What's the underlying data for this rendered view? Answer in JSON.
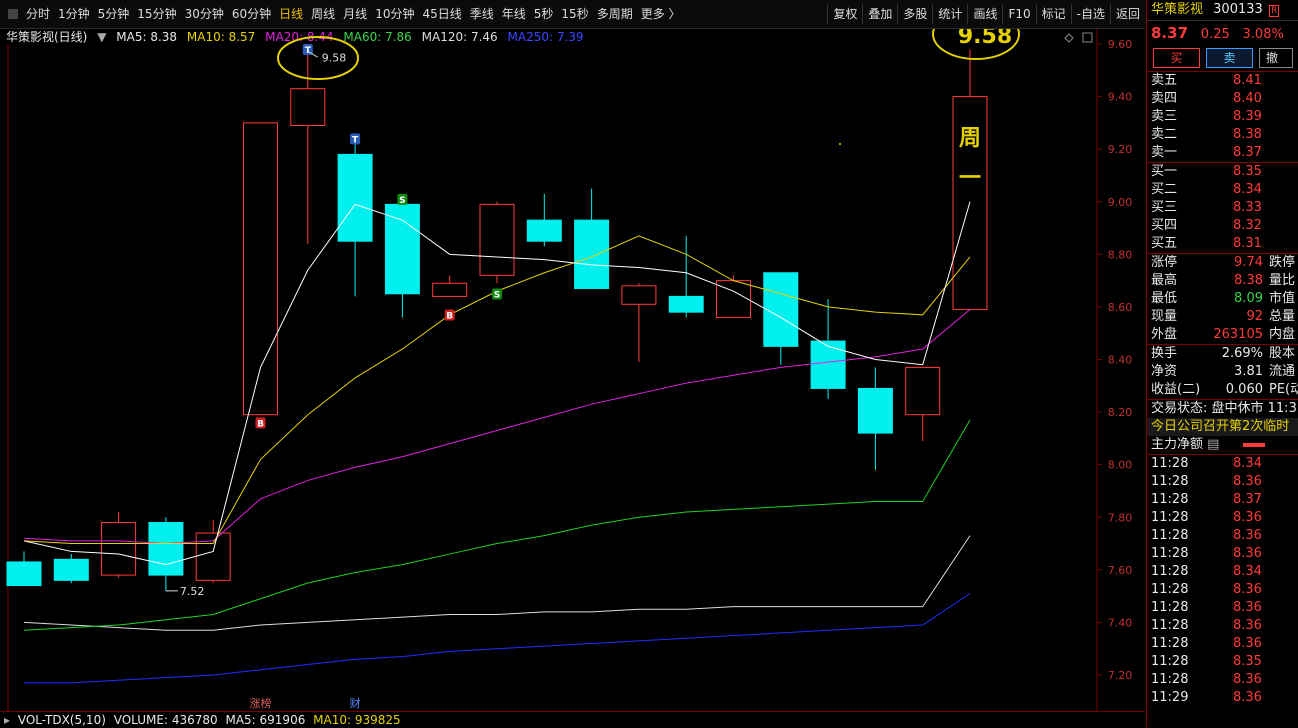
{
  "toolbar": {
    "periods": [
      "分时",
      "1分钟",
      "5分钟",
      "15分钟",
      "30分钟",
      "60分钟",
      "日线",
      "周线",
      "月线",
      "10分钟",
      "45日线",
      "季线",
      "年线",
      "5秒",
      "15秒",
      "多周期",
      "更多 〉"
    ],
    "active_period": "日线",
    "right_buttons": [
      "复权",
      "叠加",
      "多股",
      "统计",
      "画线",
      "F10",
      "标记",
      "-自选",
      "返回"
    ]
  },
  "legend": {
    "name": "华策影视(日线)",
    "ma5": "MA5: 8.38",
    "ma10": "MA10: 8.57",
    "ma20": "MA20: 8.44",
    "ma60": "MA60: 7.86",
    "ma120": "MA120: 7.46",
    "ma250": "MA250: 7.39"
  },
  "annotations": {
    "high_label": "9.58",
    "low_label": "7.52",
    "big_high": "9.58",
    "zhou": "周",
    "yi": "一",
    "zhangbang": "涨榜",
    "cai": "财",
    "marker_b": "B",
    "marker_s": "S",
    "marker_t": "T"
  },
  "axis": {
    "ticks": [
      "9.60",
      "9.40",
      "9.20",
      "9.00",
      "8.80",
      "8.60",
      "8.40",
      "8.20",
      "8.00",
      "7.80",
      "7.60",
      "7.40",
      "7.20"
    ]
  },
  "volume_bar": {
    "label": "VOL-TDX(5,10)",
    "volume": "VOLUME: 436780",
    "ma5": "MA5: 691906",
    "ma10": "MA10: 939825"
  },
  "colors": {
    "up": "#ff3b3b",
    "down": "#00f0f0",
    "ma5": "#ffffff",
    "ma10": "#e6d200",
    "ma20": "#e020e0",
    "ma60": "#20d020",
    "ma120": "#dcdcdc",
    "ma250": "#2030ff"
  },
  "chart_data": {
    "type": "candlestick",
    "ylim": [
      7.15,
      9.65
    ],
    "candles": [
      {
        "o": 7.63,
        "h": 7.67,
        "l": 7.54,
        "c": 7.54
      },
      {
        "o": 7.64,
        "h": 7.66,
        "l": 7.55,
        "c": 7.56
      },
      {
        "o": 7.58,
        "h": 7.82,
        "l": 7.57,
        "c": 7.78
      },
      {
        "o": 7.78,
        "h": 7.8,
        "l": 7.52,
        "c": 7.58
      },
      {
        "o": 7.56,
        "h": 7.79,
        "l": 7.55,
        "c": 7.74
      },
      {
        "o": 8.19,
        "h": 9.3,
        "l": 8.19,
        "c": 9.3
      },
      {
        "o": 9.29,
        "h": 9.58,
        "l": 8.84,
        "c": 9.43
      },
      {
        "o": 9.18,
        "h": 9.24,
        "l": 8.64,
        "c": 8.85
      },
      {
        "o": 8.99,
        "h": 8.99,
        "l": 8.56,
        "c": 8.65
      },
      {
        "o": 8.64,
        "h": 8.72,
        "l": 8.64,
        "c": 8.69
      },
      {
        "o": 8.72,
        "h": 9.0,
        "l": 8.69,
        "c": 8.99
      },
      {
        "o": 8.93,
        "h": 9.03,
        "l": 8.83,
        "c": 8.85
      },
      {
        "o": 8.93,
        "h": 9.05,
        "l": 8.67,
        "c": 8.67
      },
      {
        "o": 8.61,
        "h": 8.69,
        "l": 8.39,
        "c": 8.68
      },
      {
        "o": 8.64,
        "h": 8.87,
        "l": 8.56,
        "c": 8.58
      },
      {
        "o": 8.56,
        "h": 8.72,
        "l": 8.56,
        "c": 8.7
      },
      {
        "o": 8.73,
        "h": 8.73,
        "l": 8.38,
        "c": 8.45
      },
      {
        "o": 8.47,
        "h": 8.63,
        "l": 8.25,
        "c": 8.29
      },
      {
        "o": 8.29,
        "h": 8.37,
        "l": 7.98,
        "c": 8.12
      },
      {
        "o": 8.19,
        "h": 8.37,
        "l": 8.09,
        "c": 8.37
      },
      {
        "o": 8.59,
        "h": 9.58,
        "l": 8.59,
        "c": 9.4
      }
    ],
    "ma": {
      "ma5": [
        7.71,
        7.67,
        7.66,
        7.62,
        7.67,
        8.37,
        8.74,
        8.99,
        8.93,
        8.8,
        8.79,
        8.78,
        8.76,
        8.75,
        8.73,
        8.66,
        8.56,
        8.45,
        8.4,
        8.38,
        9.0
      ],
      "ma10": [
        7.71,
        7.7,
        7.7,
        7.7,
        7.7,
        8.02,
        8.19,
        8.33,
        8.44,
        8.57,
        8.66,
        8.73,
        8.79,
        8.87,
        8.8,
        8.7,
        8.65,
        8.6,
        8.58,
        8.57,
        8.79
      ],
      "ma20": [
        7.72,
        7.71,
        7.71,
        7.7,
        7.71,
        7.87,
        7.94,
        7.99,
        8.03,
        8.08,
        8.13,
        8.18,
        8.23,
        8.27,
        8.31,
        8.34,
        8.37,
        8.39,
        8.41,
        8.44,
        8.59
      ],
      "ma60": [
        7.37,
        7.38,
        7.39,
        7.41,
        7.43,
        7.49,
        7.55,
        7.59,
        7.62,
        7.66,
        7.7,
        7.73,
        7.77,
        7.8,
        7.82,
        7.83,
        7.84,
        7.85,
        7.86,
        7.86,
        8.17
      ],
      "ma120": [
        7.4,
        7.39,
        7.38,
        7.37,
        7.37,
        7.39,
        7.4,
        7.41,
        7.42,
        7.43,
        7.43,
        7.44,
        7.44,
        7.45,
        7.45,
        7.46,
        7.46,
        7.46,
        7.46,
        7.46,
        7.73
      ],
      "ma250": [
        7.17,
        7.17,
        7.18,
        7.19,
        7.2,
        7.22,
        7.24,
        7.26,
        7.27,
        7.29,
        7.3,
        7.31,
        7.32,
        7.33,
        7.34,
        7.35,
        7.36,
        7.37,
        7.38,
        7.39,
        7.51
      ]
    }
  },
  "panel": {
    "name": "华策影视",
    "code": "300133",
    "tag": "R",
    "price": "8.37",
    "change": "0.25",
    "pct": "3.08%",
    "buy": "买",
    "sell": "卖",
    "cancel": "撤",
    "asks": [
      [
        "卖五",
        "8.41"
      ],
      [
        "卖四",
        "8.40"
      ],
      [
        "卖三",
        "8.39"
      ],
      [
        "卖二",
        "8.38"
      ],
      [
        "卖一",
        "8.37"
      ]
    ],
    "bids": [
      [
        "买一",
        "8.35"
      ],
      [
        "买二",
        "8.34"
      ],
      [
        "买三",
        "8.33"
      ],
      [
        "买四",
        "8.32"
      ],
      [
        "买五",
        "8.31"
      ]
    ],
    "stats": [
      {
        "k": "涨停",
        "v": "9.74",
        "k2": "跌停"
      },
      {
        "k": "最高",
        "v": "8.38",
        "k2": "量比"
      },
      {
        "k": "最低",
        "v": "8.09",
        "k2": "市值"
      },
      {
        "k": "现量",
        "v": "92",
        "k2": "总量"
      },
      {
        "k": "外盘",
        "v": "263105",
        "k2": "内盘"
      }
    ],
    "stats2": [
      {
        "k": "换手",
        "v": "2.69%",
        "k2": "股本"
      },
      {
        "k": "净资",
        "v": "3.81",
        "k2": "流通"
      },
      {
        "k": "收益(二)",
        "v": "0.060",
        "k2": "PE(动)"
      }
    ],
    "status": "交易状态: 盘中休市 11:3",
    "news": "今日公司召开第2次临时",
    "netflow": "主力净额",
    "ticks": [
      [
        "11:28",
        "8.34"
      ],
      [
        "11:28",
        "8.36"
      ],
      [
        "11:28",
        "8.37"
      ],
      [
        "11:28",
        "8.36"
      ],
      [
        "11:28",
        "8.36"
      ],
      [
        "11:28",
        "8.36"
      ],
      [
        "11:28",
        "8.34"
      ],
      [
        "11:28",
        "8.36"
      ],
      [
        "11:28",
        "8.36"
      ],
      [
        "11:28",
        "8.36"
      ],
      [
        "11:28",
        "8.36"
      ],
      [
        "11:28",
        "8.35"
      ],
      [
        "11:28",
        "8.36"
      ],
      [
        "11:29",
        "8.36"
      ]
    ]
  }
}
